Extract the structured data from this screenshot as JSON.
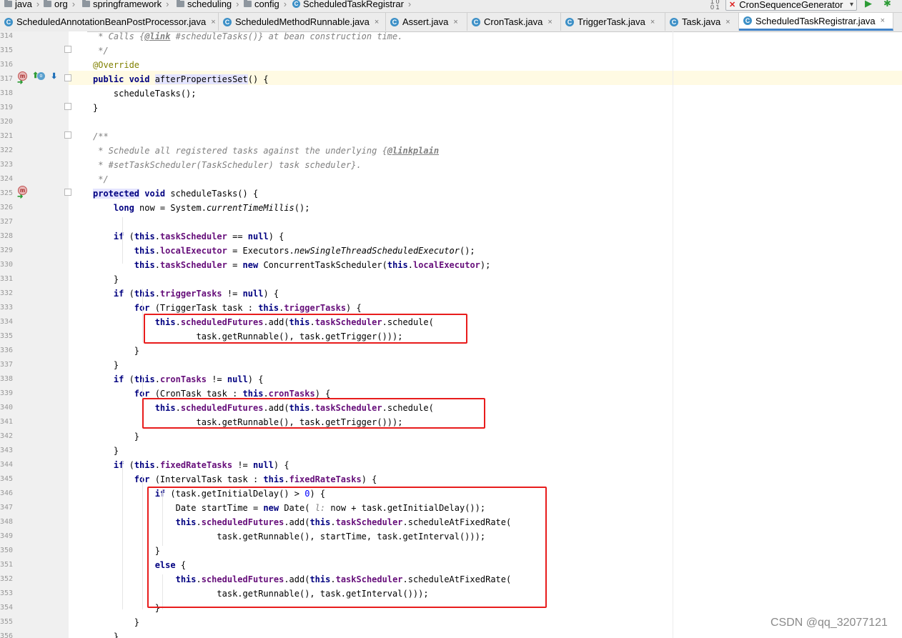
{
  "breadcrumb": {
    "items": [
      {
        "label": "java",
        "icon": "folder-icon"
      },
      {
        "label": "org",
        "icon": "folder-icon"
      },
      {
        "label": "springframework",
        "icon": "folder-icon"
      },
      {
        "label": "scheduling",
        "icon": "folder-icon"
      },
      {
        "label": "config",
        "icon": "folder-icon"
      },
      {
        "label": "ScheduledTaskRegistrar",
        "icon": "class-icon"
      }
    ]
  },
  "toolbar": {
    "run_config": "CronSequenceGenerator",
    "sort_icon_text": "1 0\n0 1"
  },
  "tabs": [
    {
      "label": "ScheduledAnnotationBeanPostProcessor.java",
      "active": false
    },
    {
      "label": "ScheduledMethodRunnable.java",
      "active": false
    },
    {
      "label": "Assert.java",
      "active": false
    },
    {
      "label": "CronTask.java",
      "active": false
    },
    {
      "label": "TriggerTask.java",
      "active": false
    },
    {
      "label": "Task.java",
      "active": false
    },
    {
      "label": "ScheduledTaskRegistrar.java",
      "active": true
    }
  ],
  "icons": {
    "class": "C",
    "close": "×",
    "method_marker": "m",
    "override_marker": "o"
  },
  "line_numbers": [
    "314",
    "315",
    "316",
    "317",
    "318",
    "319",
    "320",
    "321",
    "322",
    "323",
    "324",
    "325",
    "326",
    "327",
    "328",
    "329",
    "330",
    "331",
    "332",
    "333",
    "334",
    "335",
    "336",
    "337",
    "338",
    "339",
    "340",
    "341",
    "342",
    "343",
    "344",
    "345",
    "346",
    "347",
    "348",
    "349",
    "350",
    "351",
    "352",
    "353",
    "354",
    "355",
    "356"
  ],
  "code": {
    "l314": [
      [
        "cmt",
        " * Calls {"
      ],
      [
        "tag",
        "@link"
      ],
      [
        "cmt",
        " #scheduleTasks()} at bean construction time."
      ]
    ],
    "l315": [
      [
        "cmt",
        " */"
      ]
    ],
    "l316": [
      [
        "ann",
        "@Override"
      ]
    ],
    "l317": [
      [
        "kw",
        "public void "
      ],
      [
        "hl",
        "afterPropertiesSet"
      ],
      [
        "",
        "() {"
      ]
    ],
    "l318": [
      [
        "",
        "    scheduleTasks();"
      ]
    ],
    "l319": [
      [
        "",
        "}"
      ]
    ],
    "l320": [
      [
        "",
        ""
      ]
    ],
    "l321": [
      [
        "cmt",
        "/**"
      ]
    ],
    "l322": [
      [
        "cmt",
        " * Schedule all registered tasks against the underlying {"
      ],
      [
        "tag",
        "@linkplain"
      ]
    ],
    "l323": [
      [
        "cmt",
        " * #"
      ],
      [
        "cmti",
        "setTaskScheduler(TaskScheduler)"
      ],
      [
        "cmt",
        " task scheduler}."
      ]
    ],
    "l324": [
      [
        "cmt",
        " */"
      ]
    ],
    "l325": [
      [
        "kwh",
        "protected"
      ],
      [
        "kw",
        " void "
      ],
      [
        "",
        "scheduleTasks() {"
      ]
    ],
    "l326": [
      [
        "kw",
        "    long "
      ],
      [
        "",
        "now = System."
      ],
      [
        "st",
        "currentTimeMillis"
      ],
      [
        "",
        "();"
      ]
    ],
    "l327": [
      [
        "",
        ""
      ]
    ],
    "l328": [
      [
        "kw",
        "    if "
      ],
      [
        "",
        "("
      ],
      [
        "kw",
        "this"
      ],
      [
        "",
        "."
      ],
      [
        "fld",
        "taskScheduler"
      ],
      [
        "",
        " == "
      ],
      [
        "kw",
        "null"
      ],
      [
        "",
        ") {"
      ]
    ],
    "l329": [
      [
        "kw",
        "        this"
      ],
      [
        "",
        "."
      ],
      [
        "fld",
        "localExecutor"
      ],
      [
        "",
        " = Executors."
      ],
      [
        "st",
        "newSingleThreadScheduledExecutor"
      ],
      [
        "",
        "();"
      ]
    ],
    "l330": [
      [
        "kw",
        "        this"
      ],
      [
        "",
        "."
      ],
      [
        "fld",
        "taskScheduler"
      ],
      [
        "",
        " = "
      ],
      [
        "kw",
        "new "
      ],
      [
        "",
        "ConcurrentTaskScheduler("
      ],
      [
        "kw",
        "this"
      ],
      [
        "",
        "."
      ],
      [
        "fld",
        "localExecutor"
      ],
      [
        "",
        ");"
      ]
    ],
    "l331": [
      [
        "",
        "    }"
      ]
    ],
    "l332": [
      [
        "kw",
        "    if "
      ],
      [
        "",
        "("
      ],
      [
        "kw",
        "this"
      ],
      [
        "",
        "."
      ],
      [
        "fld",
        "triggerTasks"
      ],
      [
        "",
        " != "
      ],
      [
        "kw",
        "null"
      ],
      [
        "",
        ") {"
      ]
    ],
    "l333": [
      [
        "kw",
        "        for "
      ],
      [
        "",
        "(TriggerTask task : "
      ],
      [
        "kw",
        "this"
      ],
      [
        "",
        "."
      ],
      [
        "fld",
        "triggerTasks"
      ],
      [
        "",
        ") {"
      ]
    ],
    "l334": [
      [
        "kw",
        "            this"
      ],
      [
        "",
        "."
      ],
      [
        "fld",
        "scheduledFutures"
      ],
      [
        "",
        ".add("
      ],
      [
        "kw",
        "this"
      ],
      [
        "",
        "."
      ],
      [
        "fld",
        "taskScheduler"
      ],
      [
        "",
        ".schedule("
      ]
    ],
    "l335": [
      [
        "",
        "                    task.getRunnable(), task.getTrigger()));"
      ]
    ],
    "l336": [
      [
        "",
        "        }"
      ]
    ],
    "l337": [
      [
        "",
        "    }"
      ]
    ],
    "l338": [
      [
        "kw",
        "    if "
      ],
      [
        "",
        "("
      ],
      [
        "kw",
        "this"
      ],
      [
        "",
        "."
      ],
      [
        "fld",
        "cronTasks"
      ],
      [
        "",
        " != "
      ],
      [
        "kw",
        "null"
      ],
      [
        "",
        ") {"
      ]
    ],
    "l339": [
      [
        "kw",
        "        for "
      ],
      [
        "",
        "(CronTask task : "
      ],
      [
        "kw",
        "this"
      ],
      [
        "",
        "."
      ],
      [
        "fld",
        "cronTasks"
      ],
      [
        "",
        ") {"
      ]
    ],
    "l340": [
      [
        "kw",
        "            this"
      ],
      [
        "",
        "."
      ],
      [
        "fld",
        "scheduledFutures"
      ],
      [
        "",
        ".add("
      ],
      [
        "kw",
        "this"
      ],
      [
        "",
        "."
      ],
      [
        "fld",
        "taskScheduler"
      ],
      [
        "",
        ".schedule("
      ]
    ],
    "l341": [
      [
        "",
        "                    task.getRunnable(), task.getTrigger()));"
      ]
    ],
    "l342": [
      [
        "",
        "        }"
      ]
    ],
    "l343": [
      [
        "",
        "    }"
      ]
    ],
    "l344": [
      [
        "kw",
        "    if "
      ],
      [
        "",
        "("
      ],
      [
        "kw",
        "this"
      ],
      [
        "",
        "."
      ],
      [
        "fld",
        "fixedRateTasks"
      ],
      [
        "",
        " != "
      ],
      [
        "kw",
        "null"
      ],
      [
        "",
        ") {"
      ]
    ],
    "l345": [
      [
        "kw",
        "        for "
      ],
      [
        "",
        "(IntervalTask task : "
      ],
      [
        "kw",
        "this"
      ],
      [
        "",
        "."
      ],
      [
        "fld",
        "fixedRateTasks"
      ],
      [
        "",
        ") {"
      ]
    ],
    "l346": [
      [
        "kw",
        "            if "
      ],
      [
        "",
        "(task.getInitialDelay() > "
      ],
      [
        "num",
        "0"
      ],
      [
        "",
        ") {"
      ]
    ],
    "l347": [
      [
        "",
        "                Date startTime = "
      ],
      [
        "kw",
        "new "
      ],
      [
        "",
        "Date( "
      ],
      [
        "cmt",
        "l:"
      ],
      [
        "",
        " now + task.getInitialDelay());"
      ]
    ],
    "l348": [
      [
        "kw",
        "                this"
      ],
      [
        "",
        "."
      ],
      [
        "fld",
        "scheduledFutures"
      ],
      [
        "",
        ".add("
      ],
      [
        "kw",
        "this"
      ],
      [
        "",
        "."
      ],
      [
        "fld",
        "taskScheduler"
      ],
      [
        "",
        ".scheduleAtFixedRate("
      ]
    ],
    "l349": [
      [
        "",
        "                        task.getRunnable(), startTime, task.getInterval()));"
      ]
    ],
    "l350": [
      [
        "",
        "            }"
      ]
    ],
    "l351": [
      [
        "kw",
        "            else "
      ],
      [
        "",
        "{"
      ]
    ],
    "l352": [
      [
        "kw",
        "                this"
      ],
      [
        "",
        "."
      ],
      [
        "fld",
        "scheduledFutures"
      ],
      [
        "",
        ".add("
      ],
      [
        "kw",
        "this"
      ],
      [
        "",
        "."
      ],
      [
        "fld",
        "taskScheduler"
      ],
      [
        "",
        ".scheduleAtFixedRate("
      ]
    ],
    "l353": [
      [
        "",
        "                        task.getRunnable(), task.getInterval()));"
      ]
    ],
    "l354": [
      [
        "",
        "            }"
      ]
    ],
    "l355": [
      [
        "",
        "        }"
      ]
    ],
    "l356": [
      [
        "",
        "    }"
      ]
    ]
  },
  "watermark": "CSDN @qq_32077121",
  "colors": {
    "keyword": "#000080",
    "field": "#660e7a",
    "comment": "#808080",
    "annotation": "#808000",
    "number": "#0000ff",
    "highlight_box": "#e81c1c",
    "current_line": "#fffae3",
    "active_tab_underline": "#4083c9"
  }
}
